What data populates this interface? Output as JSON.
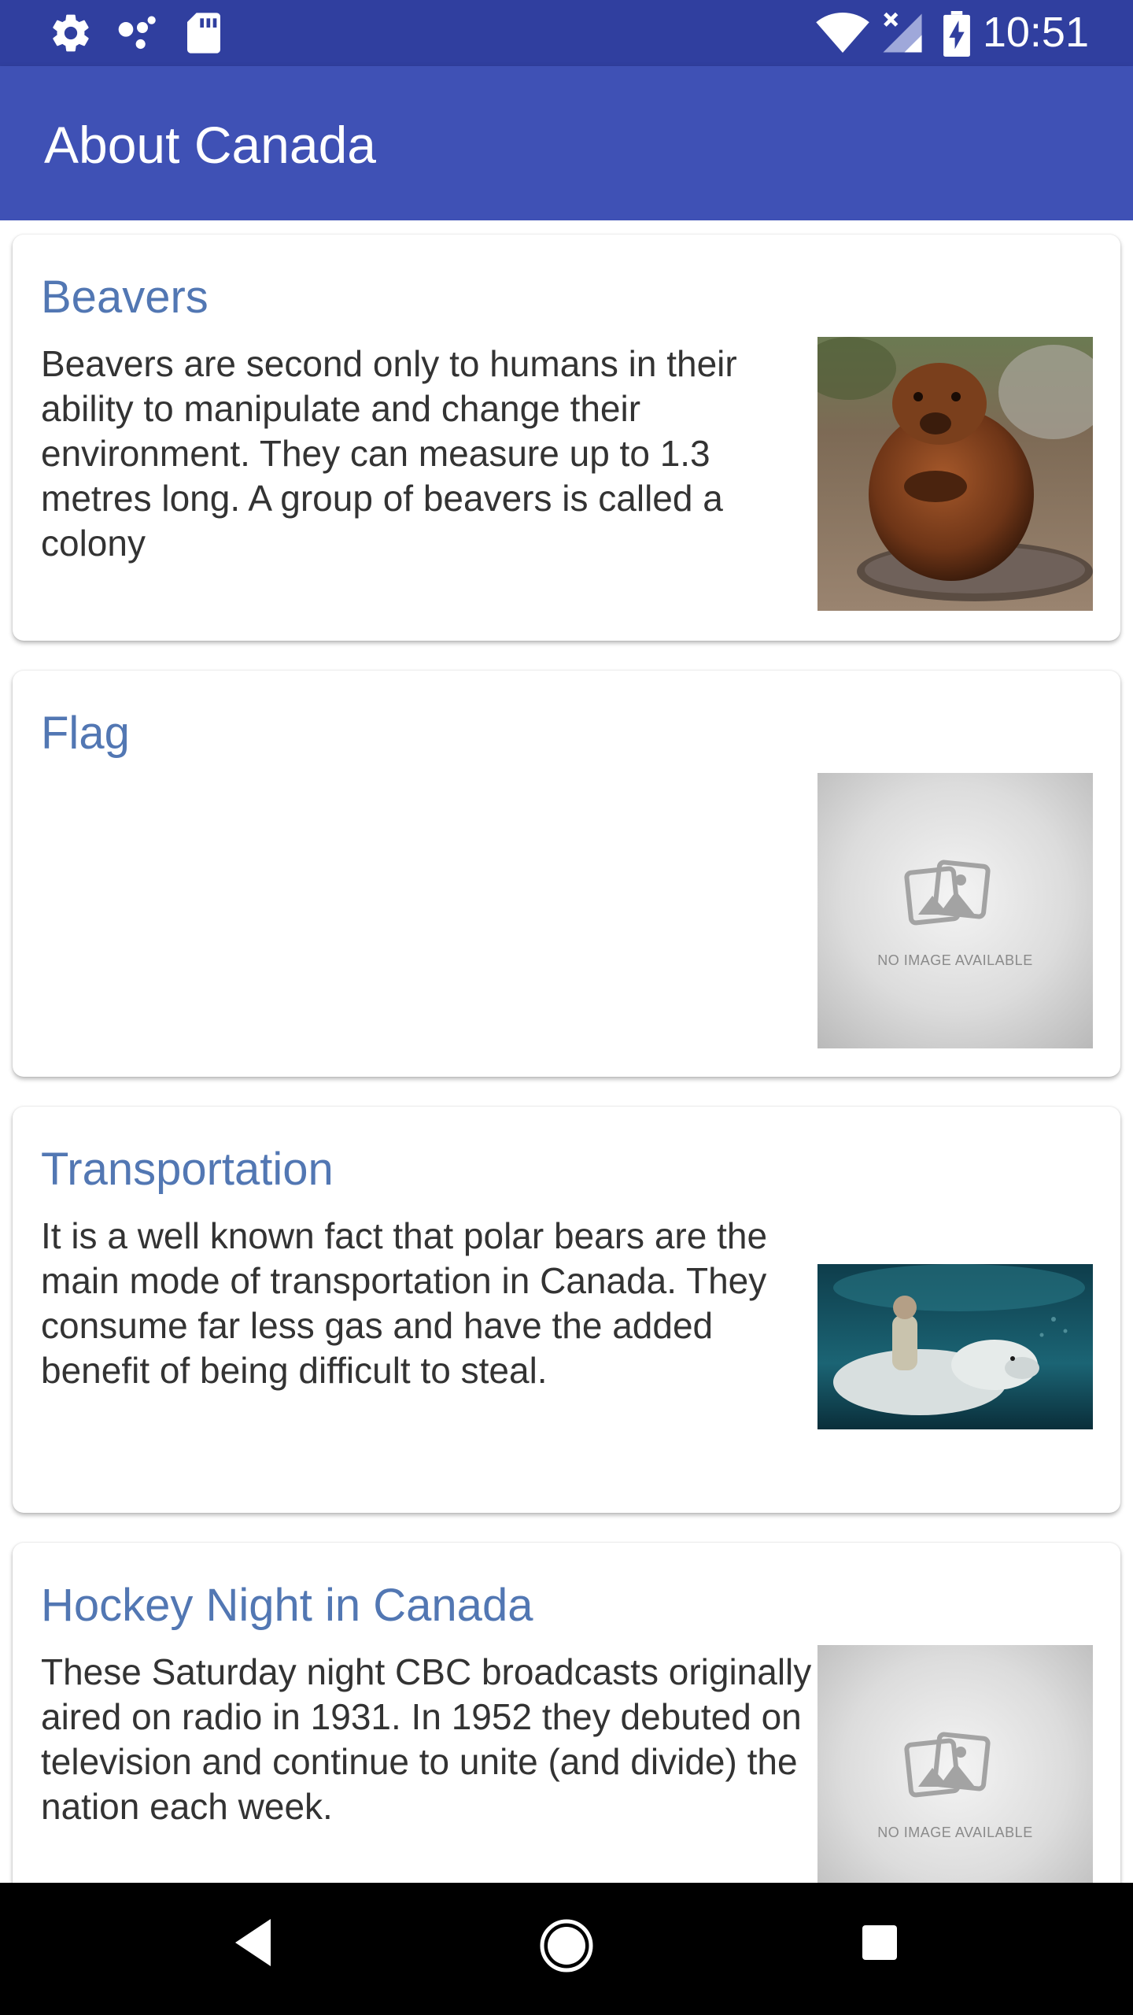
{
  "status_bar": {
    "time": "10:51",
    "icons": [
      "settings-icon",
      "notification-dots-icon",
      "sd-card-icon",
      "wifi-icon",
      "no-signal-icon",
      "battery-charging-icon"
    ]
  },
  "app_bar": {
    "title": "About Canada"
  },
  "cards": [
    {
      "title": "Beavers",
      "description": "Beavers are second only to humans in their ability to manipulate and change their environment. They can measure up to 1.3 metres long. A group of beavers is called a colony",
      "image": "beaver-photo"
    },
    {
      "title": "Flag",
      "description": "",
      "image": "no-image-placeholder",
      "image_label": "NO IMAGE AVAILABLE"
    },
    {
      "title": "Transportation",
      "description": "It is a well known fact that polar bears are the main mode of transportation in Canada. They consume far less gas and have the added benefit of being difficult to steal.",
      "image": "polar-bear-rider-photo"
    },
    {
      "title": "Hockey Night in Canada",
      "description": "These Saturday night CBC broadcasts originally aired on radio in 1931. In 1952 they debuted on television and continue to unite (and divide) the nation each week.",
      "image": "no-image-placeholder",
      "image_label": "NO IMAGE AVAILABLE"
    }
  ],
  "nav_bar": {
    "buttons": [
      "back-icon",
      "home-icon",
      "recents-icon"
    ]
  },
  "colors": {
    "status_bar": "#303f9f",
    "app_bar": "#3f51b5",
    "card_title": "#5277b3",
    "card_text": "#333333"
  }
}
